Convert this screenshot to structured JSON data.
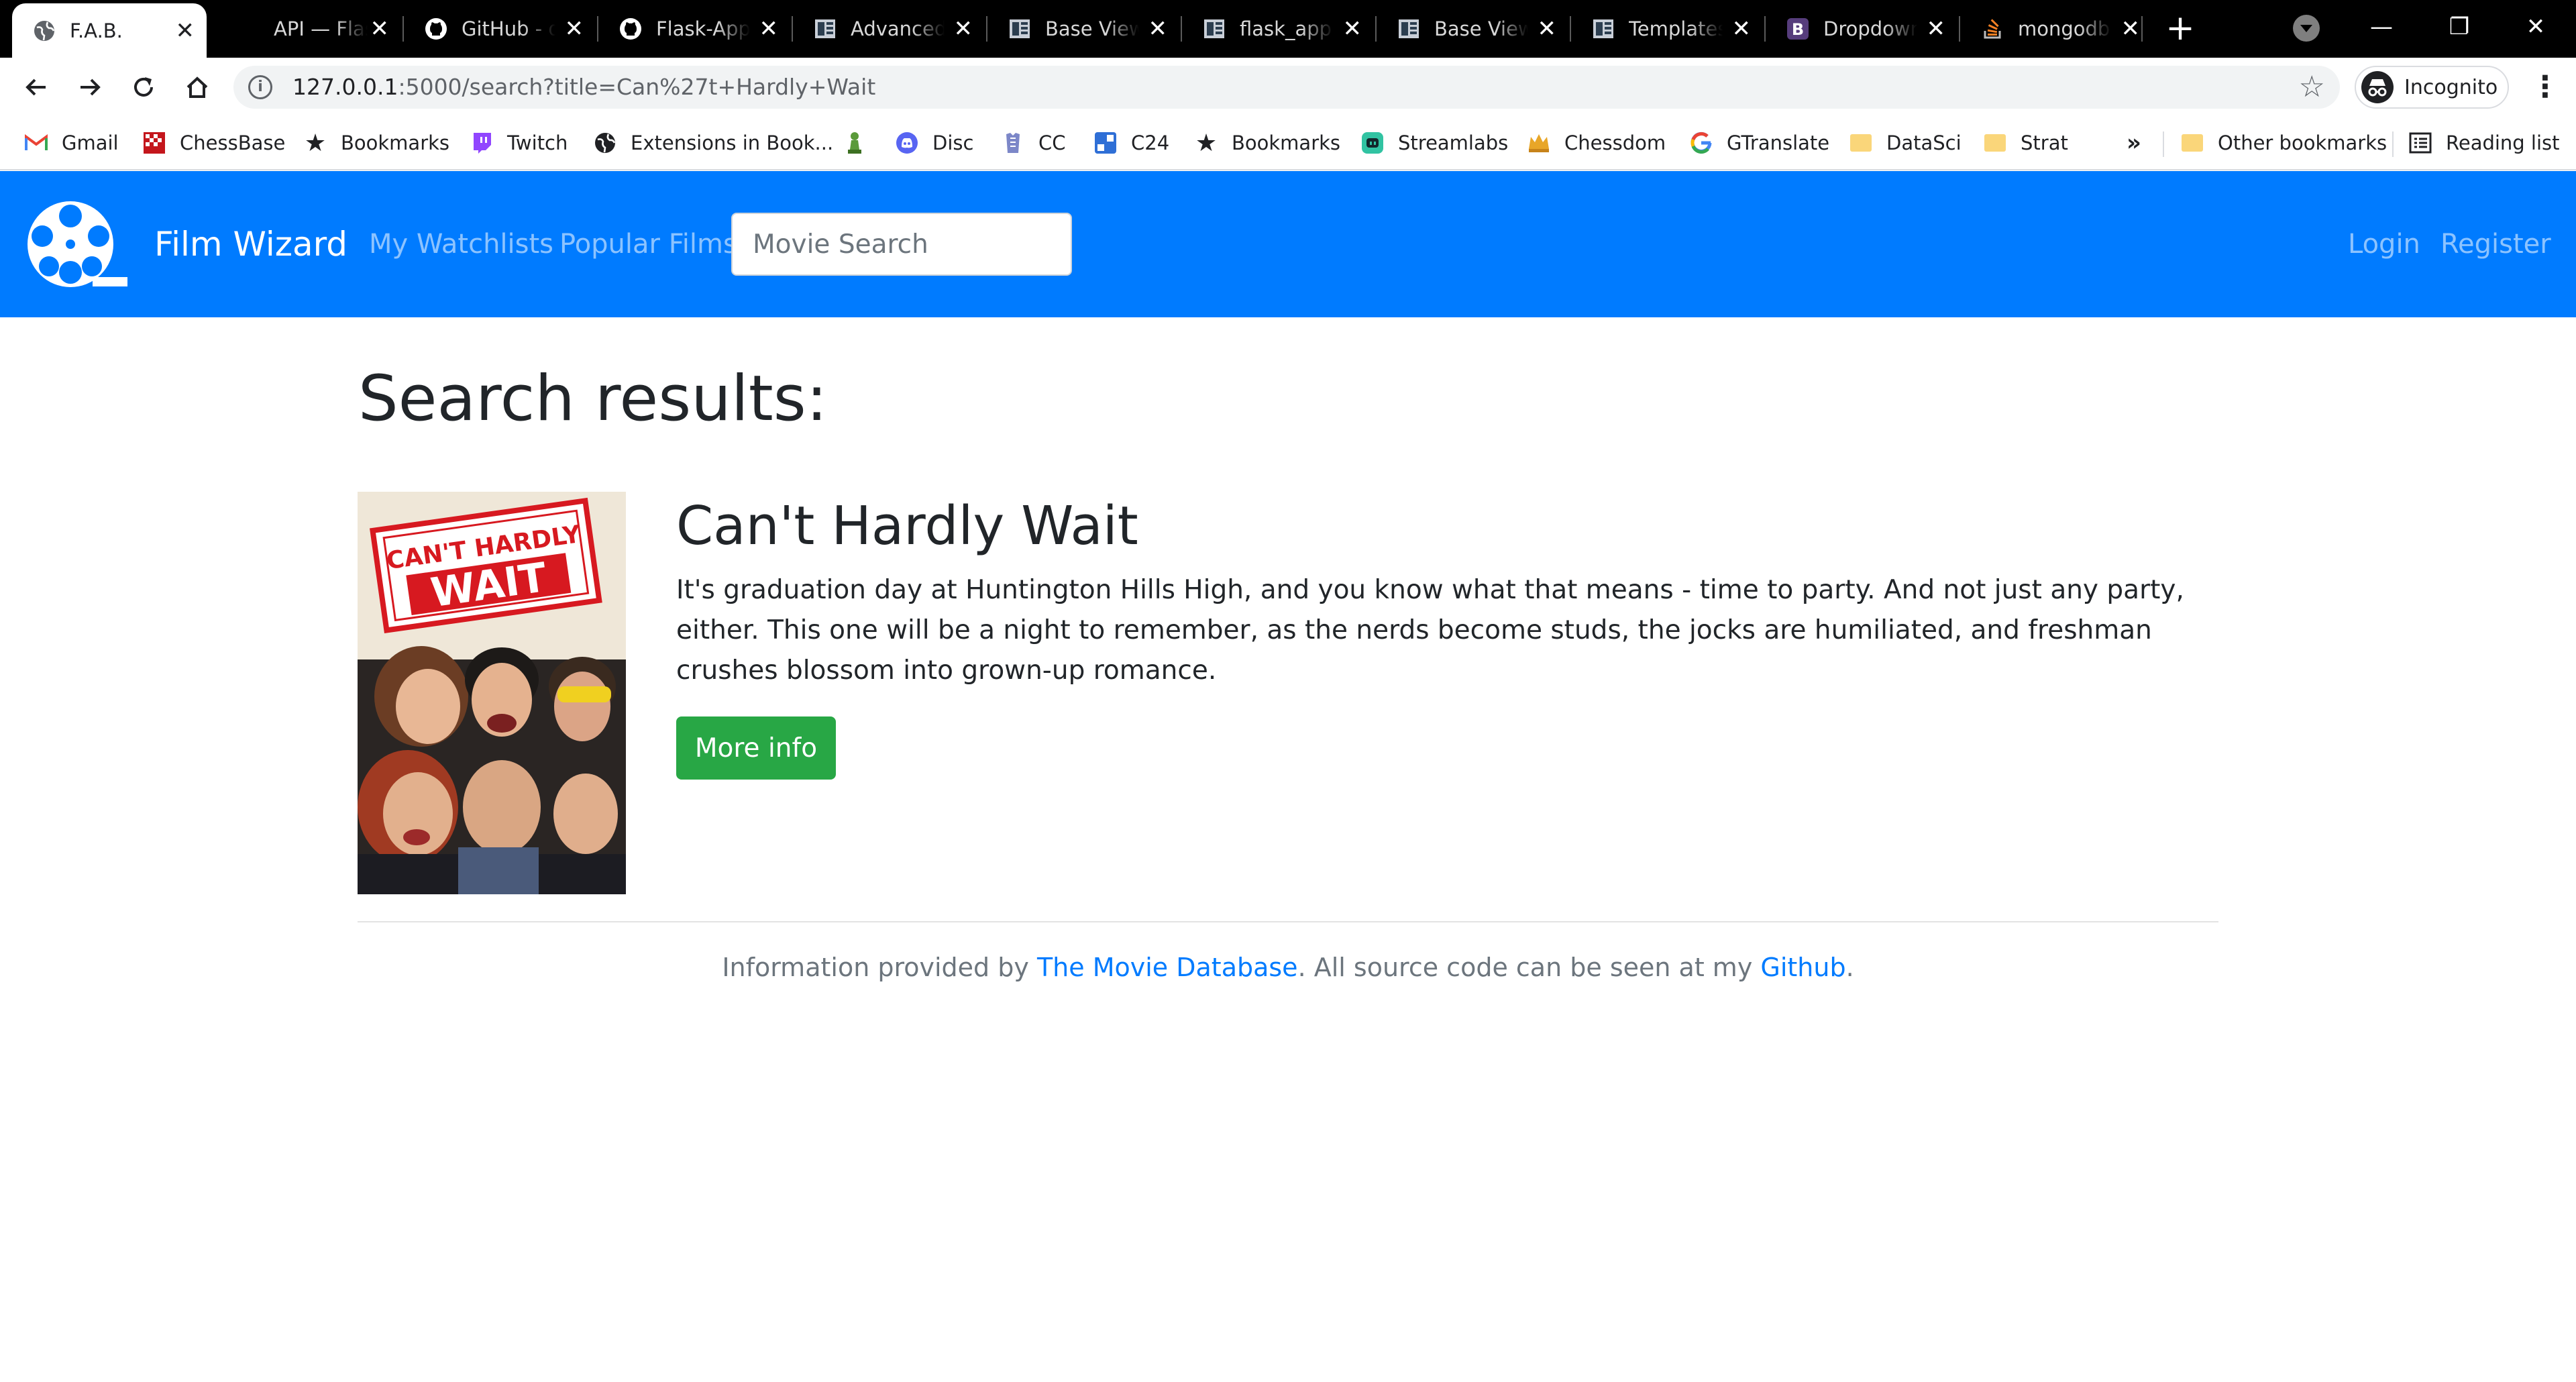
{
  "browser": {
    "tabs": [
      {
        "title": "F.A.B.",
        "icon": "globe-icon",
        "active": true
      },
      {
        "title": "API — Flask",
        "icon": "none",
        "active": false
      },
      {
        "title": "GitHub - dpgaspar",
        "icon": "github-icon",
        "active": false
      },
      {
        "title": "Flask-AppBuilder",
        "icon": "github-icon",
        "active": false
      },
      {
        "title": "Advanced Configuration",
        "icon": "fab-docs-icon",
        "active": false
      },
      {
        "title": "Base Views",
        "icon": "fab-docs-icon",
        "active": false
      },
      {
        "title": "flask_appbuilder",
        "icon": "fab-docs-icon",
        "active": false
      },
      {
        "title": "Base Views",
        "icon": "fab-docs-icon",
        "active": false
      },
      {
        "title": "Templates",
        "icon": "fab-docs-icon",
        "active": false
      },
      {
        "title": "Dropdowns",
        "icon": "bootstrap-icon",
        "active": false
      },
      {
        "title": "mongodb",
        "icon": "stackoverflow-icon",
        "active": false
      }
    ],
    "url": {
      "host": "127.0.0.1",
      "rest": ":5000/search?title=Can%27t+Hardly+Wait"
    },
    "profile_label": "Incognito",
    "bookmarks": [
      {
        "label": "Gmail",
        "icon": "gmail-icon"
      },
      {
        "label": "ChessBase",
        "icon": "chessbase-icon"
      },
      {
        "label": "Bookmarks",
        "icon": "star-icon"
      },
      {
        "label": "Twitch",
        "icon": "twitch-icon"
      },
      {
        "label": "Extensions in Book...",
        "icon": "globe-icon"
      },
      {
        "label": "",
        "icon": "chess-pawn-icon"
      },
      {
        "label": "Disc",
        "icon": "discord-icon"
      },
      {
        "label": "CC",
        "icon": "cc-icon"
      },
      {
        "label": "C24",
        "icon": "c24-icon"
      },
      {
        "label": "Bookmarks",
        "icon": "star-icon"
      },
      {
        "label": "Streamlabs",
        "icon": "streamlabs-icon"
      },
      {
        "label": "Chessdom",
        "icon": "chessdom-icon"
      },
      {
        "label": "GTranslate",
        "icon": "google-icon"
      },
      {
        "label": "DataSci",
        "icon": "folder-icon"
      },
      {
        "label": "Strat",
        "icon": "folder-icon"
      }
    ],
    "overflow_label": "»",
    "other_bookmarks_label": "Other bookmarks",
    "reading_list_label": "Reading list",
    "colors": {
      "tabstrip": "#000000",
      "toolbar": "#ffffff"
    }
  },
  "app": {
    "brand": "Film Wizard",
    "nav": {
      "watchlists": "My Watchlists",
      "popular": "Popular Films",
      "search_placeholder": "Movie Search",
      "login": "Login",
      "register": "Register"
    },
    "colors": {
      "navbar": "#007bff",
      "button": "#28a745",
      "link": "#007bff"
    }
  },
  "content": {
    "page_title": "Search results:",
    "results": [
      {
        "title": "Can't Hardly Wait",
        "overview": "It's graduation day at Huntington Hills High, and you know what that means - time to party. And not just any party, either. This one will be a night to remember, as the nerds become studs, the jocks are humiliated, and freshman crushes blossom into grown-up romance.",
        "button_label": "More info",
        "poster": {
          "text_line1": "CAN'T HARDLY",
          "text_line2": "WAIT"
        }
      }
    ]
  },
  "footer": {
    "prefix": "Information provided by ",
    "tmdb_link": "The Movie Database",
    "middle": ". All source code can be seen at my ",
    "github_link": "Github",
    "suffix": "."
  }
}
